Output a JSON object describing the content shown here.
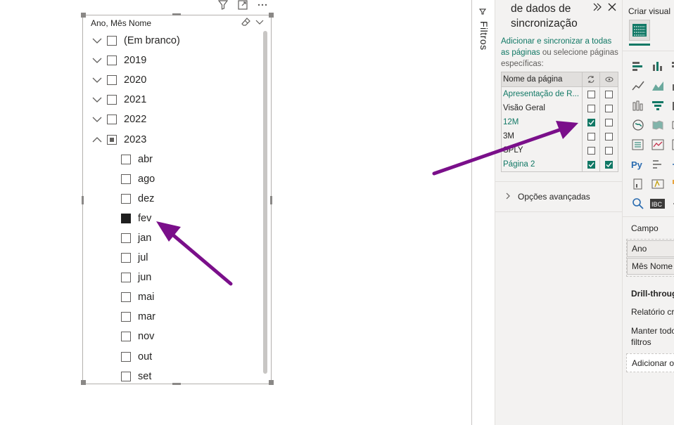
{
  "slicer": {
    "title": "Ano, Mês Nome",
    "years": [
      {
        "label": "(Em branco)",
        "expanded": false,
        "state": "unchecked"
      },
      {
        "label": "2019",
        "expanded": false,
        "state": "unchecked"
      },
      {
        "label": "2020",
        "expanded": false,
        "state": "unchecked"
      },
      {
        "label": "2021",
        "expanded": false,
        "state": "unchecked"
      },
      {
        "label": "2022",
        "expanded": false,
        "state": "unchecked"
      },
      {
        "label": "2023",
        "expanded": true,
        "state": "partial"
      }
    ],
    "months": [
      {
        "label": "abr",
        "state": "unchecked"
      },
      {
        "label": "ago",
        "state": "unchecked"
      },
      {
        "label": "dez",
        "state": "unchecked"
      },
      {
        "label": "fev",
        "state": "selected"
      },
      {
        "label": "jan",
        "state": "unchecked"
      },
      {
        "label": "jul",
        "state": "unchecked"
      },
      {
        "label": "jun",
        "state": "unchecked"
      },
      {
        "label": "mai",
        "state": "unchecked"
      },
      {
        "label": "mar",
        "state": "unchecked"
      },
      {
        "label": "nov",
        "state": "unchecked"
      },
      {
        "label": "out",
        "state": "unchecked"
      },
      {
        "label": "set",
        "state": "unchecked"
      }
    ]
  },
  "annotation_color": "#7a0f8a",
  "filters_tab": {
    "label": "Filtros"
  },
  "sync_pane": {
    "title": "de dados de sincronização",
    "desc_link": "Adicionar e sincronizar a todas as páginas",
    "desc_rest": " ou selecione páginas específicas:",
    "col_page": "Nome da página",
    "rows": [
      {
        "name": "Apresentação de R...",
        "teal": true,
        "sync": false,
        "visible": false
      },
      {
        "name": "Visão Geral",
        "teal": false,
        "sync": false,
        "visible": false
      },
      {
        "name": "12M",
        "teal": true,
        "sync": true,
        "visible": false
      },
      {
        "name": "3M",
        "teal": false,
        "sync": false,
        "visible": false
      },
      {
        "name": "SPLY",
        "teal": false,
        "sync": false,
        "visible": false
      },
      {
        "name": "Página 2",
        "teal": true,
        "sync": true,
        "visible": true
      }
    ],
    "advanced": "Opções avançadas"
  },
  "viz_pane": {
    "title": "Criar visual",
    "campo": "Campo",
    "fields": [
      "Ano",
      "Mês Nome"
    ],
    "drill": "Drill-through",
    "rel": "Relatório cruzado",
    "manter_1": "Manter todos os",
    "manter_2": "filtros",
    "adicionar": "Adicionar os campos"
  },
  "accent_color": "#117865"
}
